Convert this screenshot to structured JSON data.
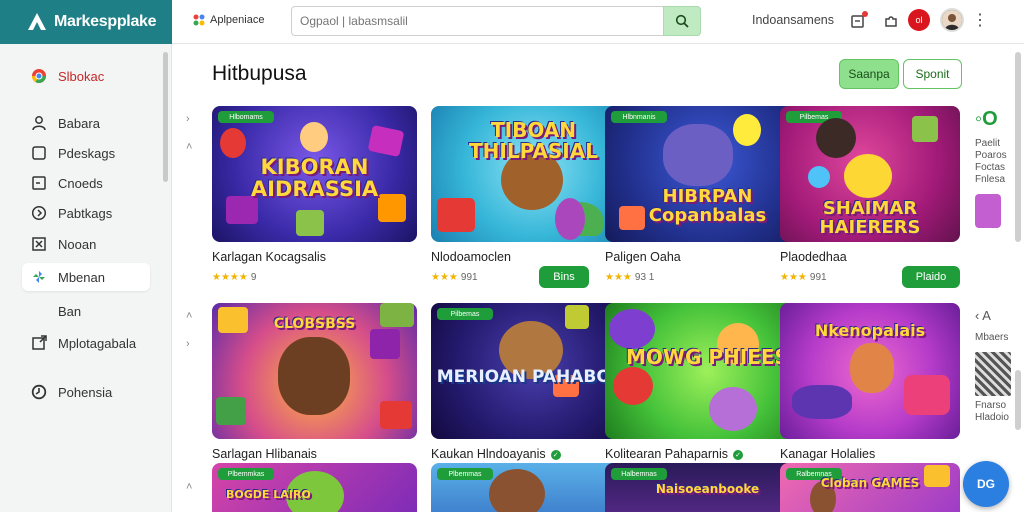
{
  "app": {
    "name": "Markespplake"
  },
  "sidebar": {
    "items": [
      {
        "label": "Slbokac",
        "icon": "chrome-icon",
        "active": false
      },
      {
        "label": "Babara",
        "icon": "user-icon",
        "active": false
      },
      {
        "label": "Pdeskags",
        "icon": "square-icon",
        "active": false
      },
      {
        "label": "Cnoeds",
        "icon": "box-icon",
        "active": false
      },
      {
        "label": "Pabtkags",
        "icon": "compass-icon",
        "active": false
      },
      {
        "label": "Nooan",
        "icon": "close-box-icon",
        "active": false
      },
      {
        "label": "Mbenan",
        "icon": "pinwheel-icon",
        "active": true
      },
      {
        "label": "Ban",
        "icon": "",
        "active": false
      },
      {
        "label": "Mplotagabala",
        "icon": "external-box-icon",
        "active": false
      },
      {
        "label": "Pohensia",
        "icon": "clock-icon",
        "active": false
      }
    ]
  },
  "topbar": {
    "logo_text": "Aplpeniace",
    "search_placeholder": "Ogpaol | labasmsalil",
    "link": "Indoansamens",
    "badge_text": "ol"
  },
  "main": {
    "title": "Hitbupusa",
    "primary_button": "Saanpa",
    "secondary_button": "Sponit"
  },
  "cards": [
    {
      "tag": "Hlbomams",
      "art_title": "KIBORAN AIDRASSIA",
      "name": "Karlagan Kocagsalis",
      "stars": "★★★★",
      "count": "9",
      "button": "",
      "verified": false
    },
    {
      "tag": "",
      "art_title": "TIBOAN THILPASIAL",
      "name": "Nlodoamoclen",
      "stars": "★★★",
      "count": "991",
      "button": "Bins",
      "verified": false
    },
    {
      "tag": "Hlbnmanis",
      "art_title": "HIBRPAN Copanbalas",
      "name": "Paligen Oaha",
      "stars": "★★★",
      "count": "93 1",
      "button": "",
      "verified": false
    },
    {
      "tag": "Pilbemas",
      "art_title": "SHAIMAR HAIERERS",
      "name": "Plaodedhaa",
      "stars": "★★★",
      "count": "991",
      "button": "Plaido",
      "verified": false
    },
    {
      "tag": "",
      "art_title": "CLOBSBSS",
      "name": "Sarlagan Hlibanais",
      "stars": "",
      "count": "",
      "button": "",
      "verified": false
    },
    {
      "tag": "Pilbemas",
      "art_title": "MERIOAN PAHABOIA",
      "name": "Kaukan Hlndoayanis",
      "stars": "",
      "count": "",
      "button": "",
      "verified": true
    },
    {
      "tag": "",
      "art_title": "MOWG PHIEES",
      "name": "Kolitearan Pahaparnis",
      "stars": "",
      "count": "",
      "button": "",
      "verified": true
    },
    {
      "tag": "",
      "art_title": "Nkenopalais",
      "name": "Kanagar Holalies",
      "stars": "",
      "count": "",
      "button": "",
      "verified": false
    },
    {
      "tag": "Plbemmkas",
      "art_title": "BOGDE LAIRO",
      "name": "",
      "stars": "",
      "count": "",
      "button": "",
      "verified": false
    },
    {
      "tag": "Plbemmas",
      "art_title": "",
      "name": "",
      "stars": "",
      "count": "",
      "button": "",
      "verified": false
    },
    {
      "tag": "Halbemnas",
      "art_title": "Naisoeanbooke",
      "name": "",
      "stars": "",
      "count": "",
      "button": "",
      "verified": false
    },
    {
      "tag": "Ralbemnas",
      "art_title": "Cloban GAMES",
      "name": "",
      "stars": "",
      "count": "",
      "button": "",
      "verified": false
    }
  ],
  "partial_right": {
    "top_text": "Paelit Poaros Foctas Fnlesa",
    "mid_label": "Mbaers",
    "mid_letter": "A",
    "lower_text": "Fnarso Hladoio"
  },
  "fab": {
    "label": "DG"
  },
  "colors": {
    "brand": "#1e7f86",
    "accent_green": "#1f9d3a",
    "search_button": "#bfeac2",
    "fab_blue": "#2a7fe0"
  }
}
